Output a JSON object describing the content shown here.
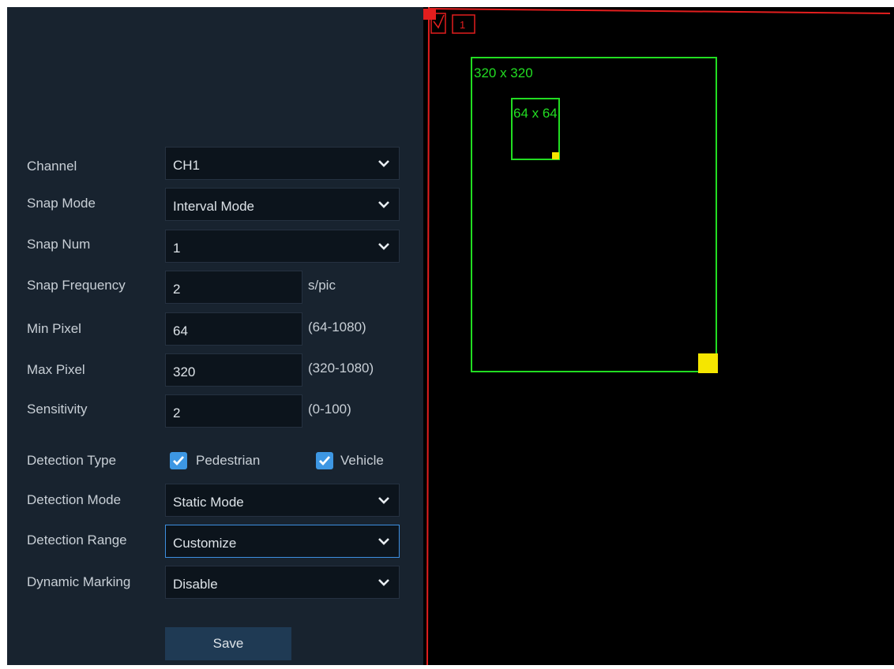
{
  "form": {
    "channel": {
      "label": "Channel",
      "value": "CH1"
    },
    "snap_mode": {
      "label": "Snap Mode",
      "value": "Interval Mode"
    },
    "snap_num": {
      "label": "Snap Num",
      "value": "1"
    },
    "snap_frequency": {
      "label": "Snap Frequency",
      "value": "2",
      "unit": "s/pic"
    },
    "min_pixel": {
      "label": "Min Pixel",
      "value": "64",
      "range": "(64-1080)"
    },
    "max_pixel": {
      "label": "Max Pixel",
      "value": "320",
      "range": "(320-1080)"
    },
    "sensitivity": {
      "label": "Sensitivity",
      "value": "2",
      "range": "(0-100)"
    },
    "detection_type": {
      "label": "Detection Type",
      "options": [
        {
          "label": "Pedestrian",
          "checked": true
        },
        {
          "label": "Vehicle",
          "checked": true
        }
      ]
    },
    "detection_mode": {
      "label": "Detection Mode",
      "value": "Static Mode"
    },
    "detection_range": {
      "label": "Detection Range",
      "value": "Customize"
    },
    "dynamic_marking": {
      "label": "Dynamic Marking",
      "value": "Disable"
    },
    "save_label": "Save"
  },
  "preview": {
    "channel_number": "1",
    "max_box_label": "320 x 320",
    "min_box_label": "64 x 64"
  },
  "colors": {
    "panel_bg": "#18232f",
    "field_bg": "#0c141c",
    "accent": "#3d97e3",
    "box_green": "#22dd22",
    "handle_yellow": "#f5e600",
    "region_red": "#e31e1e"
  }
}
